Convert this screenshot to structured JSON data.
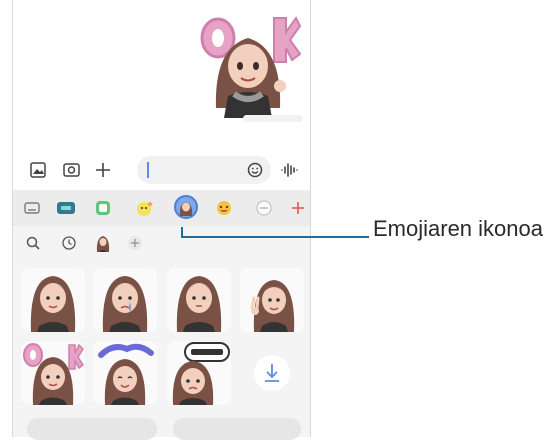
{
  "callout": {
    "label": "Emojiaren ikonoa",
    "color": "#1b6f9e"
  },
  "colors": {
    "accent": "#5a8ee6",
    "plus_red": "#e5544b",
    "hair": "#7a5145"
  },
  "icons": {
    "input_bar": [
      "gallery-icon",
      "camera-icon",
      "plus-icon",
      "emoji-icon",
      "voice-icon"
    ],
    "categories": [
      "keyboard-icon",
      "gif-icon",
      "sticker-icon",
      "bitmoji-icon",
      "ar-emoji-icon",
      "face-sticker-icon",
      "more-icon",
      "add-icon"
    ],
    "subbar": [
      "search-icon",
      "recent-icon",
      "avatar-icon",
      "add-icon"
    ]
  },
  "stickers": [
    "avatar-sticker",
    "avatar-sticker-tear",
    "avatar-sticker",
    "avatar-sticker-victory",
    "avatar-sticker-ok",
    "avatar-sticker-thanks",
    "avatar-sticker-sorry",
    "download-sticker"
  ]
}
